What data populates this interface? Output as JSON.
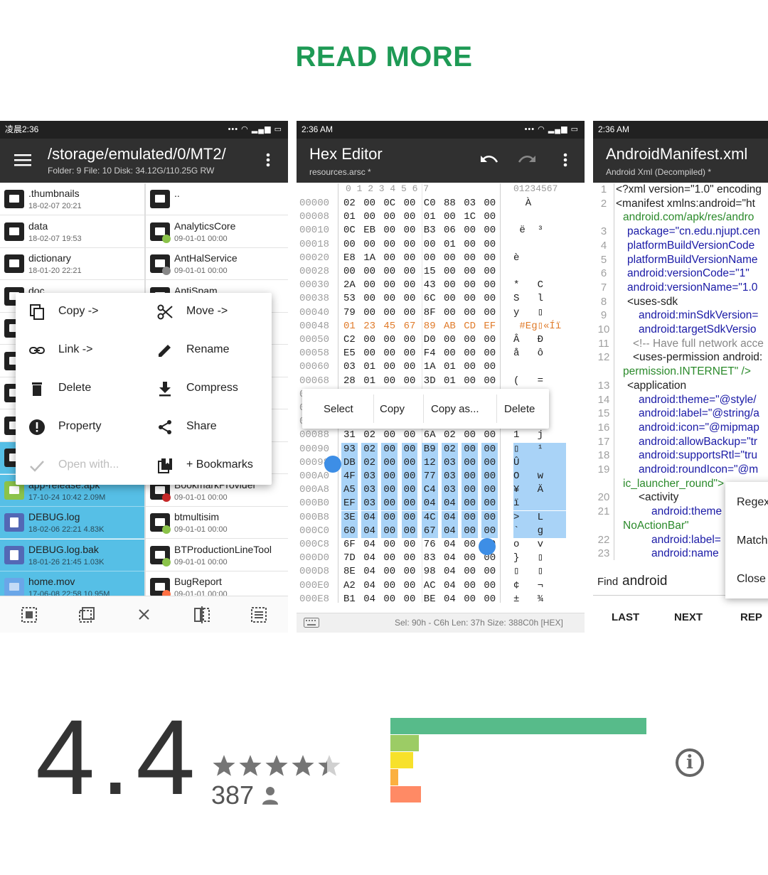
{
  "header": {
    "read_more": "READ MORE"
  },
  "shot1": {
    "status_time": "凌晨2:36",
    "status_icons": "••• ◠ ▂▄▆ ▭",
    "path": "/storage/emulated/0/MT2/",
    "path_info": "Folder: 9  File: 10  Disk: 34.12G/110.25G  RW",
    "left_files": [
      {
        "name": ".thumbnails",
        "meta": "18-02-07 20:21"
      },
      {
        "name": "data",
        "meta": "18-02-07 19:53"
      },
      {
        "name": "dictionary",
        "meta": "18-01-20 22:21"
      },
      {
        "name": "doc",
        "meta": ""
      },
      {
        "name": "",
        "meta": ""
      },
      {
        "name": "",
        "meta": ""
      },
      {
        "name": "",
        "meta": ""
      },
      {
        "name": "",
        "meta": ""
      },
      {
        "name": "",
        "meta": ""
      },
      {
        "name": "app-release.apk",
        "meta": "17-10-24 10:42  2.09M"
      },
      {
        "name": "DEBUG.log",
        "meta": "18-02-06 22:21  4.83K"
      },
      {
        "name": "DEBUG.log.bak",
        "meta": "18-01-26 21:45  1.03K"
      },
      {
        "name": "home.mov",
        "meta": "17-06-08 22:58  10.95M"
      }
    ],
    "right_files": [
      {
        "name": "..",
        "meta": ""
      },
      {
        "name": "AnalyticsCore",
        "meta": "09-01-01 00:00"
      },
      {
        "name": "AntHalService",
        "meta": "09-01-01 00:00"
      },
      {
        "name": "AntiSpam",
        "meta": ""
      },
      {
        "name": "",
        "meta": ""
      },
      {
        "name": "",
        "meta": ""
      },
      {
        "name": "",
        "meta": ""
      },
      {
        "name": "",
        "meta": ""
      },
      {
        "name": "",
        "meta": ""
      },
      {
        "name": "BookmarkProvider",
        "meta": "09-01-01 00:00"
      },
      {
        "name": "btmultisim",
        "meta": "09-01-01 00:00"
      },
      {
        "name": "BTProductionLineTool",
        "meta": "09-01-01 00:00"
      },
      {
        "name": "BugReport",
        "meta": "09-01-01 00:00"
      }
    ],
    "menu": {
      "copy": "Copy ->",
      "move": "Move ->",
      "link": "Link ->",
      "rename": "Rename",
      "delete": "Delete",
      "compress": "Compress",
      "property": "Property",
      "share": "Share",
      "open_with": "Open with...",
      "bookmarks": "+ Bookmarks"
    }
  },
  "shot2": {
    "status_time": "2:36  AM",
    "status_icons": "••• ◠ ▂▄▆ ▭",
    "title": "Hex Editor",
    "subtitle": "resources.arsc *",
    "col_header_hex": "0   1   2   3   4   5   6   7",
    "col_header_ascii": "01234567",
    "rows": [
      {
        "off": "00000",
        "bytes": [
          "02",
          "00",
          "0C",
          "00",
          "C0",
          "88",
          "03",
          "00"
        ],
        "ascii": "  À ",
        "hl": false
      },
      {
        "off": "00008",
        "bytes": [
          "01",
          "00",
          "00",
          "00",
          "01",
          "00",
          "1C",
          "00"
        ],
        "ascii": "",
        "hl": false
      },
      {
        "off": "00010",
        "bytes": [
          "0C",
          "EB",
          "00",
          "00",
          "B3",
          "06",
          "00",
          "00"
        ],
        "ascii": " ë  ³",
        "hl": false
      },
      {
        "off": "00018",
        "bytes": [
          "00",
          "00",
          "00",
          "00",
          "00",
          "01",
          "00",
          "00"
        ],
        "ascii": "",
        "hl": false
      },
      {
        "off": "00020",
        "bytes": [
          "E8",
          "1A",
          "00",
          "00",
          "00",
          "00",
          "00",
          "00"
        ],
        "ascii": "è",
        "hl": false
      },
      {
        "off": "00028",
        "bytes": [
          "00",
          "00",
          "00",
          "00",
          "15",
          "00",
          "00",
          "00"
        ],
        "ascii": "",
        "hl": false
      },
      {
        "off": "00030",
        "bytes": [
          "2A",
          "00",
          "00",
          "00",
          "43",
          "00",
          "00",
          "00"
        ],
        "ascii": "*   C",
        "hl": false
      },
      {
        "off": "00038",
        "bytes": [
          "53",
          "00",
          "00",
          "00",
          "6C",
          "00",
          "00",
          "00"
        ],
        "ascii": "S   l",
        "hl": false
      },
      {
        "off": "00040",
        "bytes": [
          "79",
          "00",
          "00",
          "00",
          "8F",
          "00",
          "00",
          "00"
        ],
        "ascii": "y   ▯",
        "hl": false
      },
      {
        "off": "00048",
        "bytes": [
          "01",
          "23",
          "45",
          "67",
          "89",
          "AB",
          "CD",
          "EF"
        ],
        "ascii": " #Eg▯«Íï",
        "hl": false
      },
      {
        "off": "00050",
        "bytes": [
          "C2",
          "00",
          "00",
          "00",
          "D0",
          "00",
          "00",
          "00"
        ],
        "ascii": "Â   Ð",
        "hl": false
      },
      {
        "off": "00058",
        "bytes": [
          "E5",
          "00",
          "00",
          "00",
          "F4",
          "00",
          "00",
          "00"
        ],
        "ascii": "å   ô",
        "hl": false
      },
      {
        "off": "00060",
        "bytes": [
          "03",
          "01",
          "00",
          "00",
          "1A",
          "01",
          "00",
          "00"
        ],
        "ascii": "",
        "hl": false
      },
      {
        "off": "00068",
        "bytes": [
          "28",
          "01",
          "00",
          "00",
          "3D",
          "01",
          "00",
          "00"
        ],
        "ascii": "(   =",
        "hl": false
      },
      {
        "off": "00070",
        "bytes": [
          "",
          "",
          "",
          "",
          "",
          "",
          "",
          ""
        ],
        "ascii": "",
        "hl": false
      },
      {
        "off": "00078",
        "bytes": [
          "",
          "",
          "",
          "",
          "",
          "",
          "",
          ""
        ],
        "ascii": "",
        "hl": false
      },
      {
        "off": "00080",
        "bytes": [
          "",
          "",
          "",
          "",
          "",
          "",
          "",
          ""
        ],
        "ascii": "",
        "hl": false
      },
      {
        "off": "00088",
        "bytes": [
          "31",
          "02",
          "00",
          "00",
          "6A",
          "02",
          "00",
          "00"
        ],
        "ascii": "1   j",
        "hl": false
      },
      {
        "off": "00090",
        "bytes": [
          "93",
          "02",
          "00",
          "00",
          "B9",
          "02",
          "00",
          "00"
        ],
        "ascii": "▯   ¹",
        "hl": true
      },
      {
        "off": "00098",
        "bytes": [
          "DB",
          "02",
          "00",
          "00",
          "12",
          "03",
          "00",
          "00"
        ],
        "ascii": "Û",
        "hl": true
      },
      {
        "off": "000A0",
        "bytes": [
          "4F",
          "03",
          "00",
          "00",
          "77",
          "03",
          "00",
          "00"
        ],
        "ascii": "O   w",
        "hl": true
      },
      {
        "off": "000A8",
        "bytes": [
          "A5",
          "03",
          "00",
          "00",
          "C4",
          "03",
          "00",
          "00"
        ],
        "ascii": "¥   Ä",
        "hl": true
      },
      {
        "off": "000B0",
        "bytes": [
          "EF",
          "03",
          "00",
          "00",
          "04",
          "04",
          "00",
          "00"
        ],
        "ascii": "ï",
        "hl": true
      },
      {
        "off": "000B8",
        "bytes": [
          "3E",
          "04",
          "00",
          "00",
          "4C",
          "04",
          "00",
          "00"
        ],
        "ascii": ">   L",
        "hl": true
      },
      {
        "off": "000C0",
        "bytes": [
          "60",
          "04",
          "00",
          "00",
          "67",
          "04",
          "00",
          "00"
        ],
        "ascii": "`   g",
        "hl": true
      },
      {
        "off": "000C8",
        "bytes": [
          "6F",
          "04",
          "00",
          "00",
          "76",
          "04",
          "00",
          "00"
        ],
        "ascii": "o   v",
        "hl": false
      },
      {
        "off": "000D0",
        "bytes": [
          "7D",
          "04",
          "00",
          "00",
          "83",
          "04",
          "00",
          "00"
        ],
        "ascii": "}   ▯",
        "hl": false
      },
      {
        "off": "000D8",
        "bytes": [
          "8E",
          "04",
          "00",
          "00",
          "98",
          "04",
          "00",
          "00"
        ],
        "ascii": "▯   ▯",
        "hl": false
      },
      {
        "off": "000E0",
        "bytes": [
          "A2",
          "04",
          "00",
          "00",
          "AC",
          "04",
          "00",
          "00"
        ],
        "ascii": "¢   ¬",
        "hl": false
      },
      {
        "off": "000E8",
        "bytes": [
          "B1",
          "04",
          "00",
          "00",
          "BE",
          "04",
          "00",
          "00"
        ],
        "ascii": "±   ¾",
        "hl": false
      }
    ],
    "ctx": {
      "select": "Select",
      "copy": "Copy",
      "copy_as": "Copy as...",
      "delete": "Delete"
    },
    "status": "Sel: 90h - C6h  Len: 37h  Size: 388C0h [HEX]"
  },
  "shot3": {
    "status_time": "2:36  AM",
    "title": "AndroidManifest.xml",
    "subtitle": "Android Xml (Decompiled) *",
    "lines": [
      {
        "n": "1",
        "t": "<?xml version=\"1.0\" encoding",
        "ind": 0,
        "cls": ""
      },
      {
        "n": "2",
        "t": "<manifest xmlns:android=\"ht",
        "ind": 0,
        "cls": ""
      },
      {
        "n": "",
        "t": "android.com/apk/res/andro",
        "ind": 10,
        "cls": "xv"
      },
      {
        "n": "3",
        "t": "package=\"cn.edu.njupt.cen",
        "ind": 16,
        "cls": "xa"
      },
      {
        "n": "4",
        "t": "platformBuildVersionCode",
        "ind": 16,
        "cls": "xa"
      },
      {
        "n": "5",
        "t": "platformBuildVersionName",
        "ind": 16,
        "cls": "xa"
      },
      {
        "n": "6",
        "t": "android:versionCode=\"1\"",
        "ind": 16,
        "cls": "xa"
      },
      {
        "n": "7",
        "t": "android:versionName=\"1.0",
        "ind": 16,
        "cls": "xa"
      },
      {
        "n": "8",
        "t": "<uses-sdk",
        "ind": 16,
        "cls": ""
      },
      {
        "n": "9",
        "t": "android:minSdkVersion=",
        "ind": 32,
        "cls": "xa"
      },
      {
        "n": "10",
        "t": "android:targetSdkVersio",
        "ind": 32,
        "cls": "xa"
      },
      {
        "n": "11",
        "t": "<!-- Have full network acce",
        "ind": 24,
        "cls": "xc"
      },
      {
        "n": "12",
        "t": "<uses-permission android:",
        "ind": 24,
        "cls": ""
      },
      {
        "n": "",
        "t": "permission.INTERNET\" />",
        "ind": 10,
        "cls": "xv"
      },
      {
        "n": "13",
        "t": "<application",
        "ind": 16,
        "cls": ""
      },
      {
        "n": "14",
        "t": "android:theme=\"@style/",
        "ind": 32,
        "cls": "xa"
      },
      {
        "n": "15",
        "t": "android:label=\"@string/a",
        "ind": 32,
        "cls": "xa"
      },
      {
        "n": "16",
        "t": "android:icon=\"@mipmap",
        "ind": 32,
        "cls": "xa"
      },
      {
        "n": "17",
        "t": "android:allowBackup=\"tr",
        "ind": 32,
        "cls": "xa"
      },
      {
        "n": "18",
        "t": "android:supportsRtl=\"tru",
        "ind": 32,
        "cls": "xa"
      },
      {
        "n": "19",
        "t": "android:roundIcon=\"@m",
        "ind": 32,
        "cls": "xa"
      },
      {
        "n": "",
        "t": "ic_launcher_round\">",
        "ind": 10,
        "cls": "xv"
      },
      {
        "n": "20",
        "t": "<activity",
        "ind": 32,
        "cls": ""
      },
      {
        "n": "21",
        "t": "android:theme",
        "ind": 50,
        "cls": "xa"
      },
      {
        "n": "",
        "t": "NoActionBar\"",
        "ind": 10,
        "cls": "xv"
      },
      {
        "n": "22",
        "t": "android:label=",
        "ind": 50,
        "cls": "xa"
      },
      {
        "n": "23",
        "t": "android:name",
        "ind": 50,
        "cls": "xa"
      }
    ],
    "find_label": "Find",
    "find_value": "android",
    "buttons": {
      "last": "LAST",
      "next": "NEXT",
      "replace": "REP"
    },
    "popup": {
      "regex": "Regex",
      "match": "Match",
      "close": "Close"
    }
  },
  "rating": {
    "value": "4.4",
    "count": "387",
    "star_color": "#757575",
    "bars": [
      {
        "stars": 5,
        "fraction": 1.0,
        "color": "#57bb8a"
      },
      {
        "stars": 4,
        "fraction": 0.11,
        "color": "#9ccc65"
      },
      {
        "stars": 3,
        "fraction": 0.09,
        "color": "#f7e12b"
      },
      {
        "stars": 2,
        "fraction": 0.03,
        "color": "#fbb040"
      },
      {
        "stars": 1,
        "fraction": 0.12,
        "color": "#ff8a65"
      }
    ]
  },
  "icons": [
    "menu-icon",
    "more-vert-icon",
    "folder-icon",
    "undo-icon",
    "redo-icon",
    "copy-icon",
    "cut-icon",
    "link-icon",
    "pencil-icon",
    "trash-icon",
    "download-icon",
    "alert-icon",
    "share-icon",
    "check-icon",
    "bookmark-icon",
    "keyboard-icon",
    "info-icon",
    "person-icon",
    "star-icon"
  ]
}
